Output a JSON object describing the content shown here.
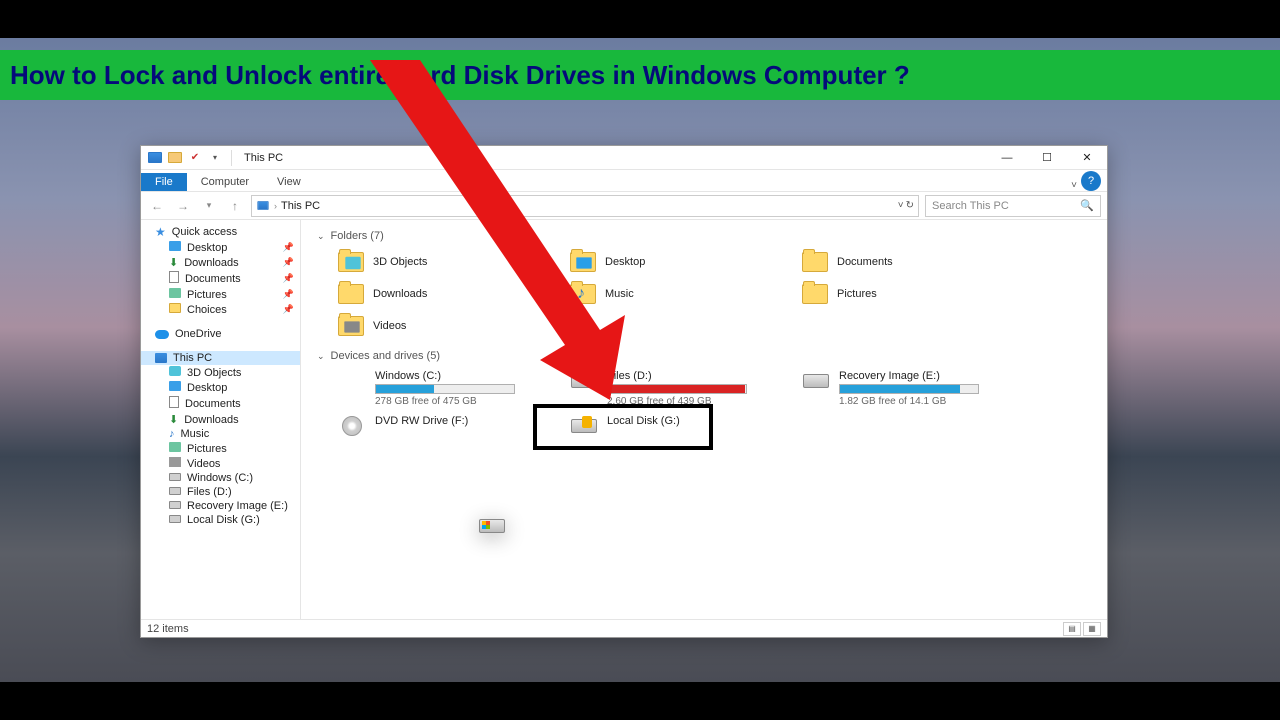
{
  "banner": {
    "text": "How to Lock and Unlock entire Hard Disk Drives in Windows Computer ?"
  },
  "window": {
    "title": "This PC",
    "tabs": {
      "file": "File",
      "computer": "Computer",
      "view": "View"
    },
    "controls": {
      "min": "—",
      "max": "☐",
      "close": "✕"
    },
    "address": {
      "crumb": "This PC",
      "refresh_tip": "↻"
    },
    "search": {
      "placeholder": "Search This PC"
    },
    "status": {
      "count": "12 items"
    }
  },
  "sidebar": {
    "quick_access": "Quick access",
    "qa_items": [
      {
        "label": "Desktop",
        "icon": "desktop"
      },
      {
        "label": "Downloads",
        "icon": "down"
      },
      {
        "label": "Documents",
        "icon": "doc"
      },
      {
        "label": "Pictures",
        "icon": "pic"
      },
      {
        "label": "Choices",
        "icon": "folder"
      }
    ],
    "onedrive": "OneDrive",
    "this_pc": "This PC",
    "pc_items": [
      {
        "label": "3D Objects",
        "icon": "obj"
      },
      {
        "label": "Desktop",
        "icon": "desktop"
      },
      {
        "label": "Documents",
        "icon": "doc"
      },
      {
        "label": "Downloads",
        "icon": "down"
      },
      {
        "label": "Music",
        "icon": "music"
      },
      {
        "label": "Pictures",
        "icon": "pic"
      },
      {
        "label": "Videos",
        "icon": "vid"
      },
      {
        "label": "Windows (C:)",
        "icon": "drive"
      },
      {
        "label": "Files (D:)",
        "icon": "drive"
      },
      {
        "label": "Recovery Image (E:)",
        "icon": "drive"
      },
      {
        "label": "Local Disk (G:)",
        "icon": "drive"
      }
    ]
  },
  "content": {
    "folders_header": "Folders (7)",
    "folders": [
      {
        "label": "3D Objects",
        "kind": "obj3d"
      },
      {
        "label": "Desktop",
        "kind": "folder-desktop"
      },
      {
        "label": "Documents",
        "kind": "folder"
      },
      {
        "label": "Downloads",
        "kind": "folder"
      },
      {
        "label": "Music",
        "kind": "folder-music"
      },
      {
        "label": "Pictures",
        "kind": "folder"
      },
      {
        "label": "Videos",
        "kind": "folder-video"
      }
    ],
    "drives_header": "Devices and drives (5)",
    "drives": [
      {
        "name": "Windows (C:)",
        "sub": "278 GB free of 475 GB",
        "fill": 42,
        "color": "#26a0da",
        "kind": "win"
      },
      {
        "name": "Files (D:)",
        "sub": "2.60 GB free of 439 GB",
        "fill": 99,
        "color": "#d92323",
        "kind": "hdd"
      },
      {
        "name": "Recovery Image (E:)",
        "sub": "1.82 GB free of 14.1 GB",
        "fill": 87,
        "color": "#26a0da",
        "kind": "hdd"
      },
      {
        "name": "DVD RW Drive (F:)",
        "sub": "",
        "fill": 0,
        "color": "",
        "kind": "dvd"
      },
      {
        "name": "Local Disk (G:)",
        "sub": "",
        "fill": 0,
        "color": "",
        "kind": "locked"
      }
    ]
  }
}
